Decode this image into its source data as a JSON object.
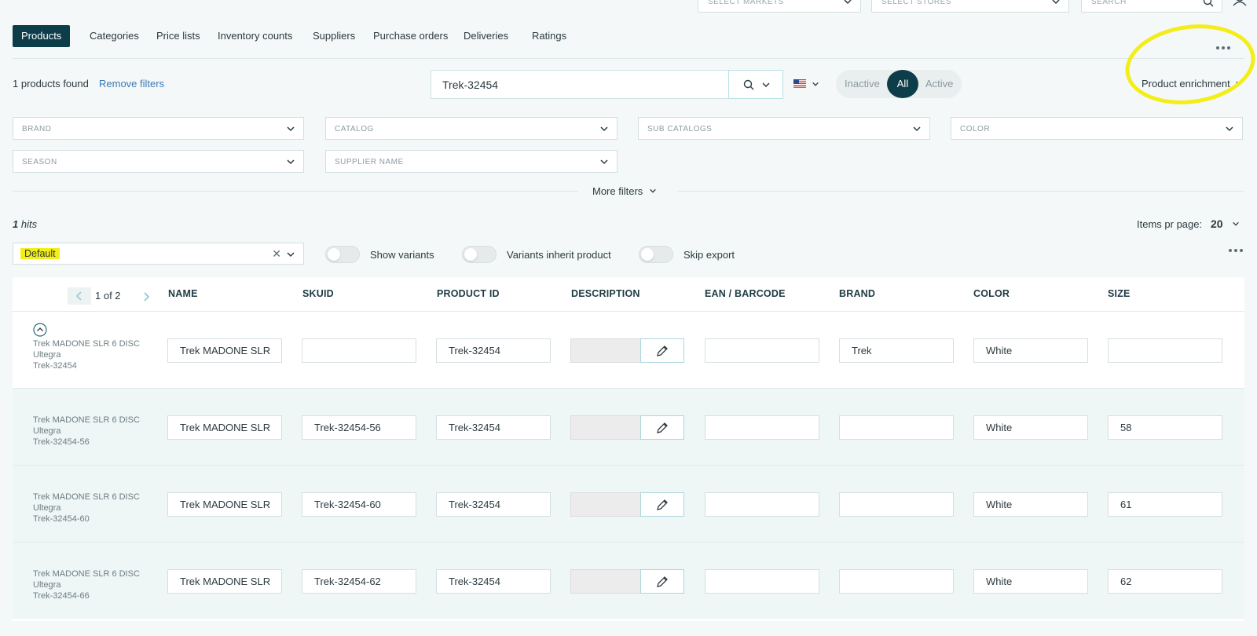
{
  "top": {
    "markets_placeholder": "SELECT MARKETS",
    "stores_placeholder": "SELECT STORES",
    "search_placeholder": "SEARCH"
  },
  "nav": {
    "tabs": [
      {
        "label": "Products",
        "active": true
      },
      {
        "label": "Categories"
      },
      {
        "label": "Price lists"
      },
      {
        "label": "Inventory counts"
      },
      {
        "label": "Suppliers"
      },
      {
        "label": "Purchase orders"
      },
      {
        "label": "Deliveries"
      },
      {
        "label": "Ratings"
      }
    ]
  },
  "results": {
    "found": "1 products found",
    "remove_filters": "Remove filters"
  },
  "search": {
    "value": "Trek-32454",
    "flag": "us-flag-icon"
  },
  "status_toggle": {
    "inactive": "Inactive",
    "all": "All",
    "active": "Active"
  },
  "enrichment": {
    "label": "Product enrichment"
  },
  "filters": {
    "brand": "BRAND",
    "catalog": "CATALOG",
    "sub_catalogs": "SUB CATALOGS",
    "color": "COLOR",
    "season": "SEASON",
    "supplier_name": "SUPPLIER NAME",
    "more": "More filters"
  },
  "hits": {
    "count": "1",
    "suffix": " hits",
    "items_per_page_label": "Items pr page:",
    "items_per_page": "20"
  },
  "view": {
    "preset": "Default"
  },
  "switches": {
    "show_variants": "Show variants",
    "variants_inherit": "Variants inherit product",
    "skip_export": "Skip export"
  },
  "table": {
    "pager": "1 of 2",
    "headers": {
      "name": "NAME",
      "skuid": "SKUID",
      "product_id": "PRODUCT ID",
      "description": "DESCRIPTION",
      "ean": "EAN / BARCODE",
      "brand": "BRAND",
      "color": "COLOR",
      "size": "SIZE"
    },
    "rows": [
      {
        "title": "Trek MADONE SLR 6 DISC Ultegra",
        "code": "Trek-32454",
        "name": "Trek MADONE SLR",
        "skuid": "",
        "product_id": "Trek-32454",
        "ean": "",
        "brand": "Trek",
        "color": "White",
        "size": ""
      },
      {
        "title": "Trek MADONE SLR 6 DISC Ultegra",
        "code": "Trek-32454-56",
        "name": "Trek MADONE SLR",
        "skuid": "Trek-32454-56",
        "product_id": "Trek-32454",
        "ean": "",
        "brand": "",
        "color": "White",
        "size": "58"
      },
      {
        "title": "Trek MADONE SLR 6 DISC Ultegra",
        "code": "Trek-32454-60",
        "name": "Trek MADONE SLR",
        "skuid": "Trek-32454-60",
        "product_id": "Trek-32454",
        "ean": "",
        "brand": "",
        "color": "White",
        "size": "61"
      },
      {
        "title": "Trek MADONE SLR 6 DISC Ultegra",
        "code": "Trek-32454-66",
        "name": "Trek MADONE SLR",
        "skuid": "Trek-32454-62",
        "product_id": "Trek-32454",
        "ean": "",
        "brand": "",
        "color": "White",
        "size": "62"
      }
    ]
  },
  "colors": {
    "primary": "#0e3d4a",
    "accent_link": "#3a7ab5",
    "highlight": "#f3ee1a",
    "variant_row_bg": "#eef6f6"
  }
}
